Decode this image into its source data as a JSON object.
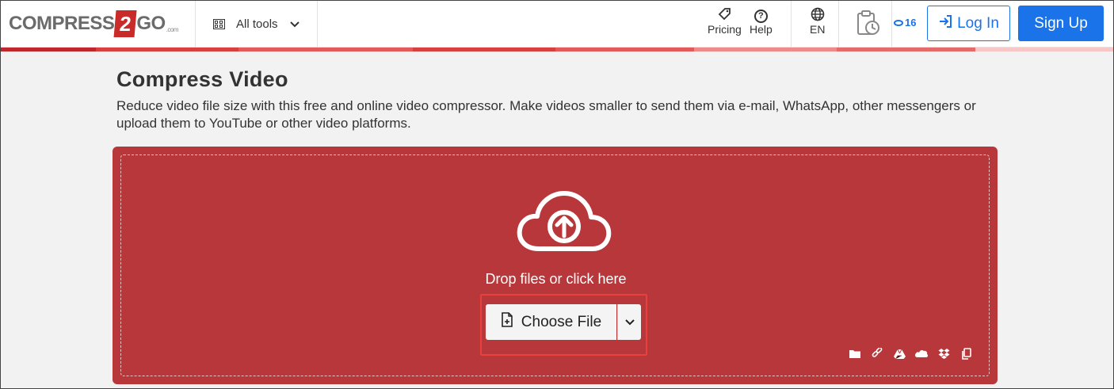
{
  "header": {
    "logo": {
      "part1": "COMPRESS",
      "part2": "2",
      "part3": "GO",
      "suffix": ".com"
    },
    "all_tools": "All tools",
    "pricing": "Pricing",
    "help": "Help",
    "language": "EN",
    "credits": "16",
    "login": "Log In",
    "signup": "Sign Up"
  },
  "page": {
    "title": "Compress Video",
    "description": "Reduce video file size with this free and online video compressor. Make videos smaller to send them via e-mail, WhatsApp, other messengers or upload them to YouTube or other video platforms."
  },
  "upload": {
    "drop_text": "Drop files or click here",
    "choose_file": "Choose File",
    "sources": [
      "folder-icon",
      "link-icon",
      "google-drive-icon",
      "onedrive-icon",
      "dropbox-icon",
      "clipboard-icon"
    ]
  },
  "colors": {
    "brand_red": "#b8373a",
    "accent_blue": "#1a73e8"
  }
}
